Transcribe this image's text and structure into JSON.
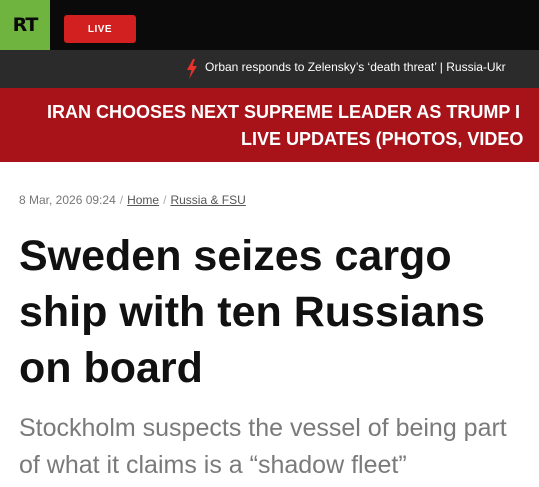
{
  "header": {
    "logo_text": "RT",
    "live_label": "LIVE",
    "colors": {
      "logo_bg": "#6fb43f",
      "live_bg": "#d21f1f",
      "bar_bg": "#0a0a0a"
    }
  },
  "ticker": {
    "icon": "lightning-bolt-icon",
    "text": "Orban responds to Zelensky’s ‘death threat’ | Russia-Ukr"
  },
  "breaking_banner": {
    "line1": "IRAN CHOOSES NEXT SUPREME LEADER AS TRUMP I",
    "line2": "LIVE UPDATES (PHOTOS, VIDEO",
    "color": "#a8131a"
  },
  "article": {
    "date": "8 Mar, 2026 09:24",
    "breadcrumb": [
      {
        "label": "Home"
      },
      {
        "label": "Russia & FSU"
      }
    ],
    "title": "Sweden seizes cargo ship with ten Russians on board",
    "summary": "Stockholm suspects the vessel of being part of what it claims is a “shadow fleet”"
  }
}
